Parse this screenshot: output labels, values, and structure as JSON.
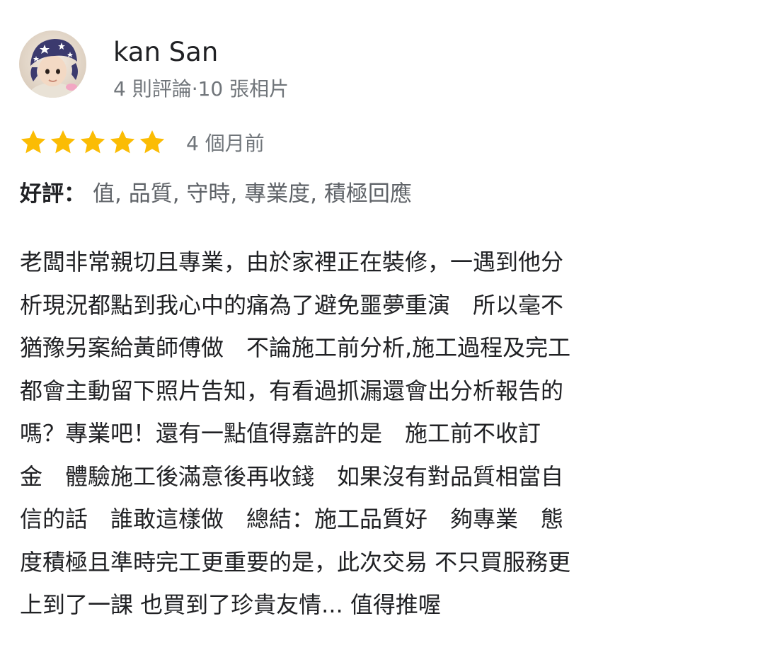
{
  "reviewer": {
    "name": "kan San",
    "stats": "4 則評論·10 張相片",
    "avatar_icon": "child-avatar-photo"
  },
  "rating": {
    "stars": 5,
    "max_stars": 5,
    "star_color": "#fbbc04",
    "time_ago": "4 個月前"
  },
  "positive": {
    "label": "好評：",
    "values": "值, 品質, 守時, 專業度, 積極回應"
  },
  "review": {
    "lines": [
      "老闆非常親切且專業，由於家裡正在裝修，一遇到他分",
      "析現況都點到我心中的痛為了避免噩夢重演　所以毫不",
      "猶豫另案給黃師傅做　不論施工前分析,施工過程及完工",
      "都會主動留下照片告知，有看過抓漏還會出分析報告的",
      "嗎？專業吧！還有一點值得嘉許的是　施工前不收訂",
      "金　體驗施工後滿意後再收錢　如果沒有對品質相當自",
      "信的話　誰敢這樣做　總結：施工品質好　夠專業　態",
      "度積極且準時完工更重要的是，此次交易 不只買服務更",
      "上到了一課 也買到了珍貴友情... 值得推喔"
    ]
  }
}
